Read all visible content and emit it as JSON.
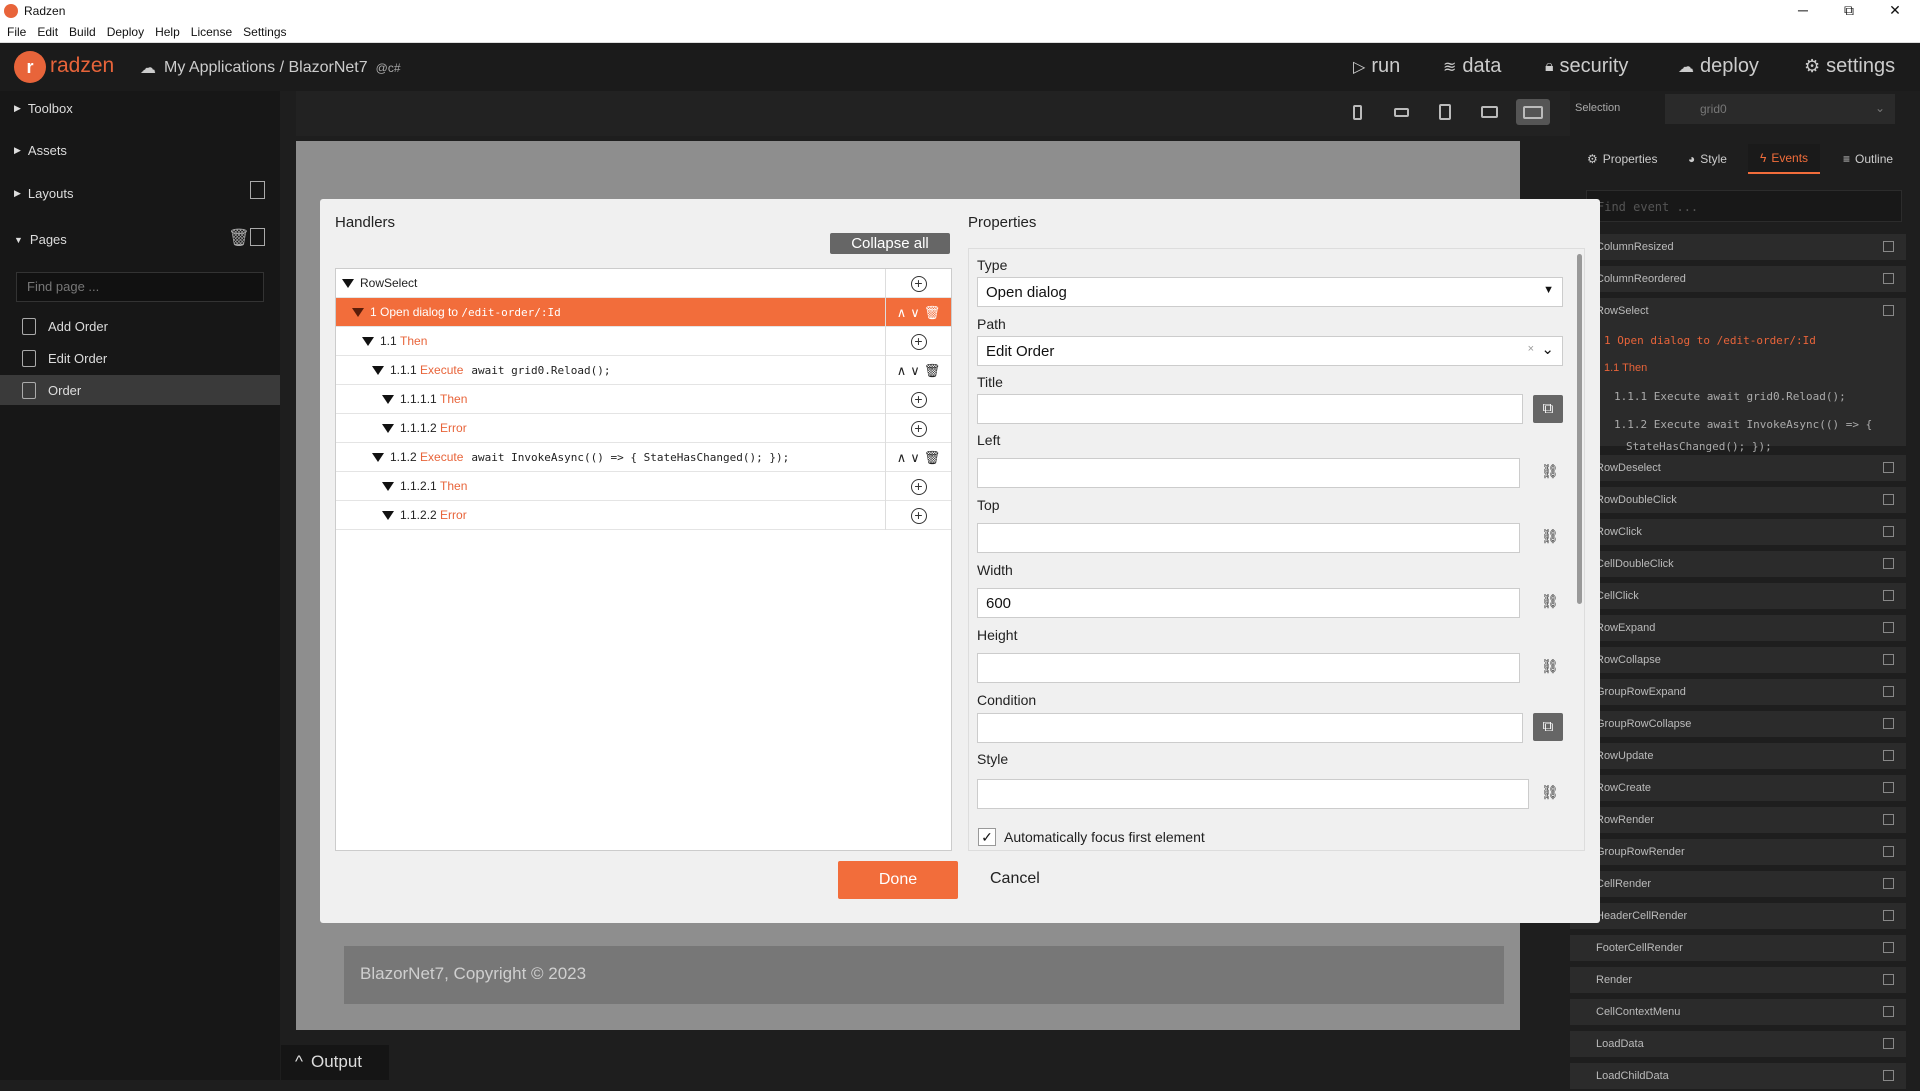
{
  "window": {
    "title": "Radzen",
    "minimize": "─",
    "maximize": "⧉",
    "close": "✕"
  },
  "menu": [
    "File",
    "Edit",
    "Build",
    "Deploy",
    "Help",
    "License",
    "Settings"
  ],
  "header": {
    "logo_text": "radzen",
    "breadcrumb": "My Applications / BlazorNet7",
    "project_badge": "@c#",
    "nav": {
      "run": "run",
      "data": "data",
      "security": "security",
      "deploy": "deploy",
      "settings": "settings"
    }
  },
  "sidebar": {
    "sections": {
      "toolbox": "Toolbox",
      "assets": "Assets",
      "layouts": "Layouts",
      "pages": "Pages"
    },
    "find_placeholder": "Find page ...",
    "pages": [
      "Add Order",
      "Edit Order",
      "Order"
    ],
    "selected_page": "Order"
  },
  "canvas": {
    "footer": "BlazorNet7, Copyright © 2023",
    "output_tab": "Output"
  },
  "right_panel": {
    "selection_label": "Selection",
    "selection_value": "grid0",
    "tabs": {
      "properties": "Properties",
      "style": "Style",
      "events": "Events",
      "outline": "Outline"
    },
    "active_tab": "Events",
    "find_event_placeholder": "Find event ...",
    "events_top": [
      "ColumnResized",
      "ColumnReordered",
      "RowSelect"
    ],
    "row_select_tree": {
      "h1": "1 Open dialog to /edit-order/:Id",
      "h11": "1.1 Then",
      "h111": "1.1.1 Execute  await grid0.Reload();",
      "h112": "1.1.2 Execute  await InvokeAsync(() => {",
      "h112b": "StateHasChanged(); });"
    },
    "events_rest": [
      "RowDeselect",
      "RowDoubleClick",
      "RowClick",
      "CellDoubleClick",
      "CellClick",
      "RowExpand",
      "RowCollapse",
      "GroupRowExpand",
      "GroupRowCollapse",
      "RowUpdate",
      "RowCreate",
      "RowRender",
      "GroupRowRender",
      "CellRender",
      "HeaderCellRender",
      "FooterCellRender",
      "Render",
      "CellContextMenu",
      "LoadData",
      "LoadChildData"
    ]
  },
  "dialog": {
    "handlers_title": "Handlers",
    "collapse_all": "Collapse all",
    "tree": [
      {
        "text": "RowSelect",
        "kw": "",
        "code": "",
        "indent": 0
      },
      {
        "text": "1 Open dialog to ",
        "kw": "",
        "code": "/edit-order/:Id",
        "indent": 1,
        "selected": true
      },
      {
        "text": "1.1 ",
        "kw": "Then",
        "code": "",
        "indent": 2
      },
      {
        "text": "1.1.1 ",
        "kw": "Execute",
        "code": "await grid0.Reload();",
        "indent": 3
      },
      {
        "text": "1.1.1.1 ",
        "kw": "Then",
        "code": "",
        "indent": 4
      },
      {
        "text": "1.1.1.2 ",
        "kw": "Error",
        "code": "",
        "indent": 4
      },
      {
        "text": "1.1.2 ",
        "kw": "Execute",
        "code": "await InvokeAsync(() => { StateHasChanged(); });",
        "indent": 3
      },
      {
        "text": "1.1.2.1 ",
        "kw": "Then",
        "code": "",
        "indent": 4
      },
      {
        "text": "1.1.2.2 ",
        "kw": "Error",
        "code": "",
        "indent": 4
      }
    ],
    "properties_title": "Properties",
    "type_label": "Type",
    "type_value": "Open dialog",
    "path_label": "Path",
    "path_value": "Edit Order",
    "title_label": "Title",
    "title_value": "",
    "left_label": "Left",
    "left_value": "",
    "top_label": "Top",
    "top_value": "",
    "width_label": "Width",
    "width_value": "600",
    "height_label": "Height",
    "height_value": "",
    "condition_label": "Condition",
    "condition_value": "",
    "style_label": "Style",
    "style_value": "",
    "autofocus_label": "Automatically focus first element",
    "autofocus_checked": true,
    "done": "Done",
    "cancel": "Cancel"
  },
  "colors": {
    "accent": "#f26d3b",
    "dark": "#1e1e1e"
  }
}
